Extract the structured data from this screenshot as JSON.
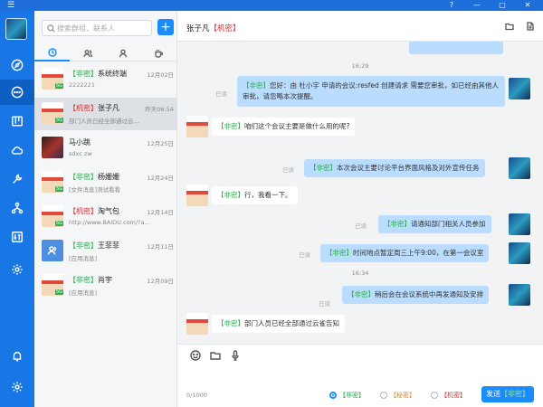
{
  "titlebar": {
    "menu_icon": "menu-icon",
    "help": "?",
    "min": "—",
    "restore": "▢",
    "close": "✕"
  },
  "rail": {
    "items": [
      "chat",
      "projects",
      "cloud",
      "tools",
      "org",
      "settings",
      "notifications",
      "preferences"
    ]
  },
  "search": {
    "placeholder": "搜索群组、联系人"
  },
  "tabs": [
    "recent",
    "groups",
    "contacts",
    "apps"
  ],
  "conversations": [
    {
      "tag": "【非密】",
      "tag_type": "g",
      "name": "系统终端",
      "time": "12月02日",
      "preview": "2222221",
      "badge": "5G"
    },
    {
      "tag": "【机密】",
      "tag_type": "r",
      "name": "张子凡",
      "time": "昨天06:54",
      "preview": "部门人员已经全部通过云…",
      "badge": "5G"
    },
    {
      "tag": "",
      "tag_type": "",
      "name": "马小跳",
      "time": "12月25日",
      "preview": "sdxc zw",
      "badge": ""
    },
    {
      "tag": "【非密】",
      "tag_type": "g",
      "name": "杨姗姗",
      "time": "12月24日",
      "preview": "[文件消息]测试看看",
      "badge": "5G"
    },
    {
      "tag": "【机密】",
      "tag_type": "r",
      "name": "淘气包",
      "time": "12月14日",
      "preview": "http://www.BAIDU.com/?a…",
      "badge": "5G"
    },
    {
      "tag": "【非密】",
      "tag_type": "g",
      "name": "王菲菲",
      "time": "12月11日",
      "preview": "[应用消息]",
      "badge": ""
    },
    {
      "tag": "【非密】",
      "tag_type": "g",
      "name": "肖宇",
      "time": "12月09日",
      "preview": "[应用消息]",
      "badge": "5G"
    }
  ],
  "chat": {
    "title_name": "张子凡",
    "title_tag": "【机密】",
    "folder_icon": "folder-icon",
    "file_icon": "file-icon",
    "messages": [
      {
        "kind": "time",
        "text": "16:29"
      },
      {
        "kind": "out",
        "tag": "【非密】",
        "text": "您好：由 杜小宇 申请的会议:resfed 创建请求 需要您审批，如已经由其他人审批，请忽略本次提醒。",
        "read": "已读",
        "multiline": true
      },
      {
        "kind": "in",
        "tag": "【非密】",
        "text": "咱们这个会议主要是做什么用的呢?"
      },
      {
        "kind": "out",
        "tag": "【非密】",
        "text": "本次会议主要讨论平台界面风格及对外宣传任务",
        "read": "已读"
      },
      {
        "kind": "in",
        "tag": "【非密】",
        "text": "行，我看一下。"
      },
      {
        "kind": "out",
        "tag": "【非密】",
        "text": "请通知部门相关人员参加",
        "read": "已读"
      },
      {
        "kind": "out",
        "tag": "【非密】",
        "text": "时间地点暂定周三上午9:00，在第一会议室",
        "read": "已读"
      },
      {
        "kind": "time",
        "text": "16:34"
      },
      {
        "kind": "out",
        "tag": "【非密】",
        "text": "稍后会在会议系统中再发通知及安排",
        "read": "已读"
      },
      {
        "kind": "in",
        "tag": "【非密】",
        "text": "部门人员已经全部通过云雀告知"
      }
    ]
  },
  "composer": {
    "counter": "0/1000",
    "levels": [
      {
        "label": "【非密】",
        "type": "g",
        "selected": true
      },
      {
        "label": "【秘密】",
        "type": "o",
        "selected": false
      },
      {
        "label": "【机密】",
        "type": "r",
        "selected": false
      }
    ],
    "send_label": "发送",
    "send_tag": "【非密】"
  }
}
